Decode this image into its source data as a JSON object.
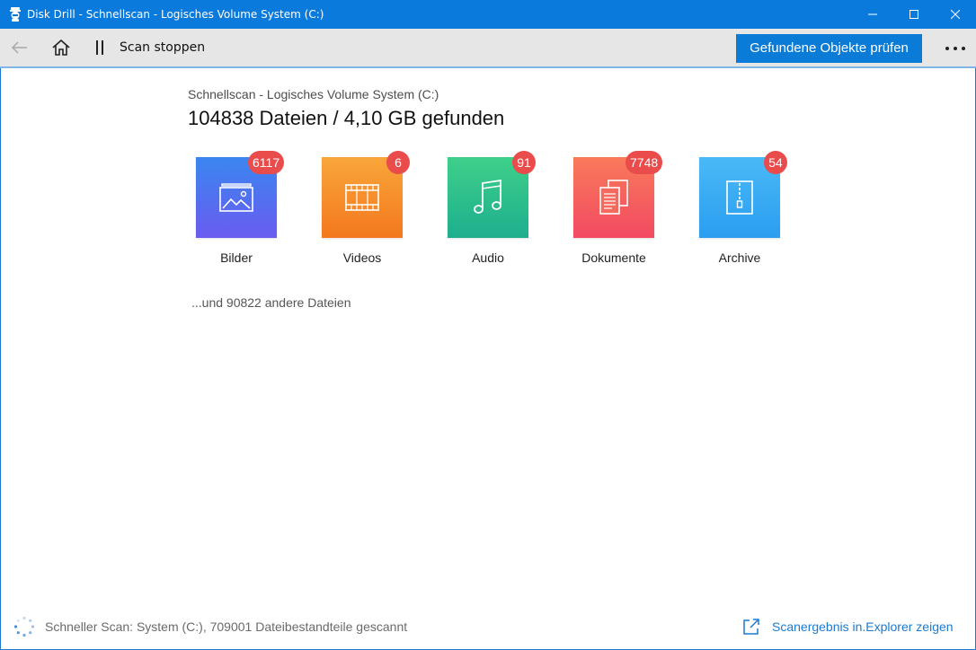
{
  "window": {
    "title": "Disk Drill - Schnellscan - Logisches Volume System (C:)"
  },
  "toolbar": {
    "stop_label": "Scan stoppen",
    "review_button": "Gefundene Objekte prüfen"
  },
  "header": {
    "subtitle": "Schnellscan - Logisches Volume System (C:)",
    "headline": "104838 Dateien / 4,10 GB gefunden"
  },
  "categories": [
    {
      "label": "Bilder",
      "count": "6117",
      "icon": "image-icon",
      "color_top": "#3a86f0",
      "color_bottom": "#6a5cf0"
    },
    {
      "label": "Videos",
      "count": "6",
      "icon": "film-icon",
      "color_top": "#f8a63a",
      "color_bottom": "#f4781e"
    },
    {
      "label": "Audio",
      "count": "91",
      "icon": "music-note-icon",
      "color_top": "#3ed08a",
      "color_bottom": "#1eae8e"
    },
    {
      "label": "Dokumente",
      "count": "7748",
      "icon": "documents-icon",
      "color_top": "#f97a5a",
      "color_bottom": "#f24a62"
    },
    {
      "label": "Archive",
      "count": "54",
      "icon": "archive-zip-icon",
      "color_top": "#4ab9f6",
      "color_bottom": "#2a9ef0"
    }
  ],
  "other_files": "...und 90822 andere Dateien",
  "status": {
    "text": "Schneller Scan: System (C:), 709001 Dateibestandteile gescannt",
    "explorer_link": "Scanergebnis in.Explorer zeigen"
  },
  "colors": {
    "titlebar": "#0a7bdc",
    "accent": "#0a7bd6",
    "badge": "#ea4b4b",
    "link": "#1a7ad2"
  }
}
